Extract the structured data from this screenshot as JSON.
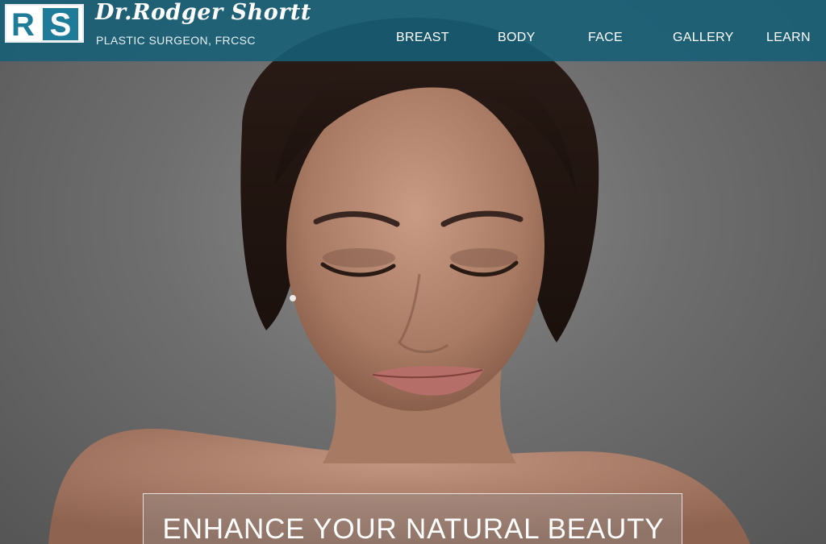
{
  "header": {
    "logo": {
      "letters_left": "R",
      "letters_right": "S"
    },
    "brand_name": "Dr.Rodger Shortt",
    "brand_subtitle": "PLASTIC SURGEON, FRCSC"
  },
  "nav": {
    "items": [
      {
        "label": "BREAST"
      },
      {
        "label": "BODY"
      },
      {
        "label": "FACE"
      },
      {
        "label": "GALLERY"
      },
      {
        "label": "LEARN"
      }
    ]
  },
  "hero": {
    "banner_text": "ENHANCE YOUR NATURAL BEAUTY"
  },
  "colors": {
    "header_bg": "#166078",
    "logo_accent": "#1f7c98",
    "text_light": "#ffffff"
  }
}
